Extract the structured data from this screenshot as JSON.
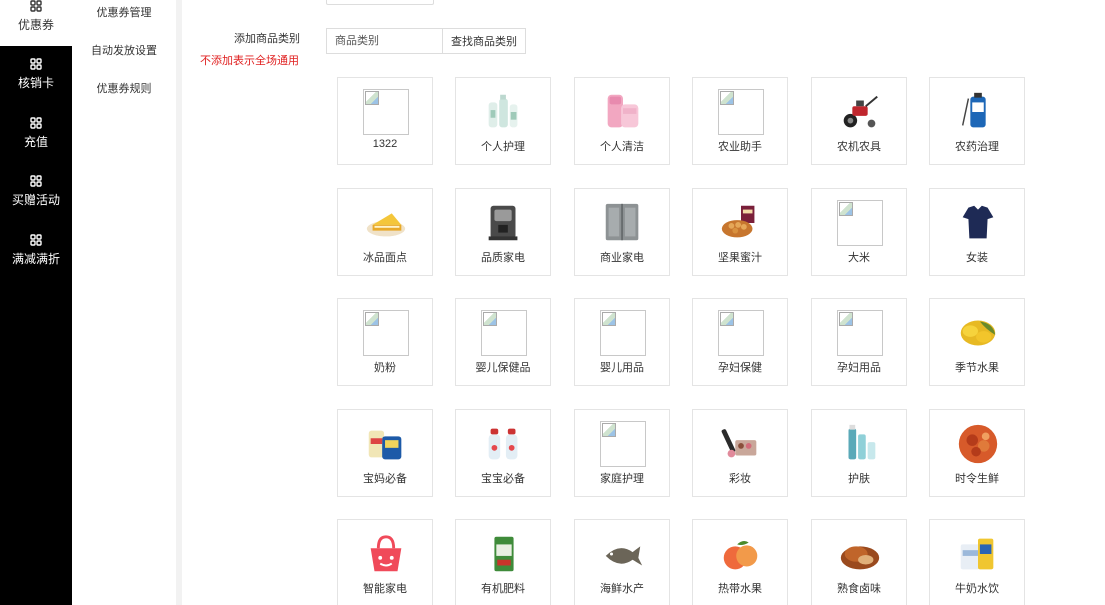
{
  "nav": {
    "items": [
      {
        "label": "优惠券",
        "icon": "grid-icon",
        "active": true
      },
      {
        "label": "核销卡",
        "icon": "grid-icon",
        "active": false
      },
      {
        "label": "充值",
        "icon": "grid-icon",
        "active": false
      },
      {
        "label": "买赠活动",
        "icon": "grid-icon",
        "active": false
      },
      {
        "label": "满减满折",
        "icon": "grid-icon",
        "active": false
      }
    ]
  },
  "subnav": {
    "items": [
      {
        "label": "优惠券管理"
      },
      {
        "label": "自动发放设置"
      },
      {
        "label": "优惠券规则"
      }
    ]
  },
  "form": {
    "add_category_label": "添加商品类别",
    "note": "不添加表示全场通用",
    "search_placeholder": "商品类别",
    "search_button": "查找商品类别"
  },
  "categories": [
    {
      "name": "1322",
      "icon": "broken-image"
    },
    {
      "name": "个人护理",
      "icon": "lotion-bottles"
    },
    {
      "name": "个人清洁",
      "icon": "pink-towels"
    },
    {
      "name": "农业助手",
      "icon": "broken-image"
    },
    {
      "name": "农机农具",
      "icon": "tiller-machine"
    },
    {
      "name": "农药治理",
      "icon": "sprayer-tank"
    },
    {
      "name": "冰品面点",
      "icon": "cake-slice"
    },
    {
      "name": "品质家电",
      "icon": "coffee-machine"
    },
    {
      "name": "商业家电",
      "icon": "commercial-fridge"
    },
    {
      "name": "坚果蜜汁",
      "icon": "nuts-bowl"
    },
    {
      "name": "大米",
      "icon": "broken-image"
    },
    {
      "name": "女装",
      "icon": "blouse"
    },
    {
      "name": "奶粉",
      "icon": "broken-image"
    },
    {
      "name": "婴儿保健品",
      "icon": "broken-image"
    },
    {
      "name": "婴儿用品",
      "icon": "broken-image"
    },
    {
      "name": "孕妇保健",
      "icon": "broken-image"
    },
    {
      "name": "孕妇用品",
      "icon": "broken-image"
    },
    {
      "name": "季节水果",
      "icon": "durian"
    },
    {
      "name": "宝妈必备",
      "icon": "formula-cans"
    },
    {
      "name": "宝宝必备",
      "icon": "baby-bottles"
    },
    {
      "name": "家庭护理",
      "icon": "broken-image"
    },
    {
      "name": "彩妆",
      "icon": "makeup-set"
    },
    {
      "name": "护肤",
      "icon": "skincare-bottles"
    },
    {
      "name": "时令生鲜",
      "icon": "crayfish"
    },
    {
      "name": "智能家电",
      "icon": "shopping-bag"
    },
    {
      "name": "有机肥料",
      "icon": "fertilizer-bag"
    },
    {
      "name": "海鲜水产",
      "icon": "fish"
    },
    {
      "name": "热带水果",
      "icon": "peaches"
    },
    {
      "name": "熟食卤味",
      "icon": "braised-meat"
    },
    {
      "name": "牛奶水饮",
      "icon": "milk-box"
    }
  ]
}
